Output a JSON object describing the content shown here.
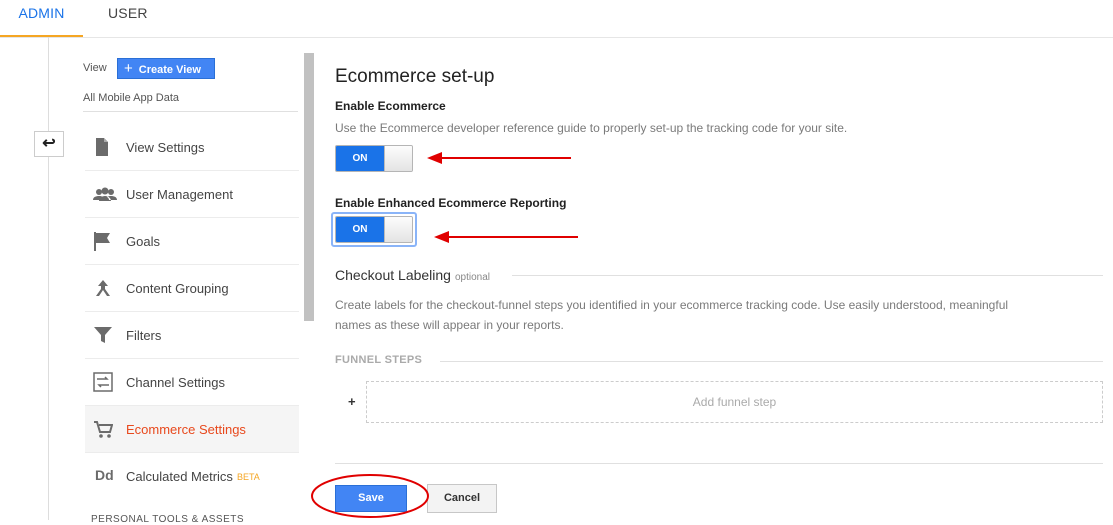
{
  "tabs": {
    "admin": "ADMIN",
    "user": "USER"
  },
  "sidebar": {
    "view_label": "View",
    "create_view": "Create View",
    "view_name": "All Mobile App Data",
    "items": [
      {
        "label": "View Settings",
        "icon": "document-icon"
      },
      {
        "label": "User Management",
        "icon": "people-icon"
      },
      {
        "label": "Goals",
        "icon": "flag-icon"
      },
      {
        "label": "Content Grouping",
        "icon": "grouping-icon"
      },
      {
        "label": "Filters",
        "icon": "filter-icon"
      },
      {
        "label": "Channel Settings",
        "icon": "channel-icon"
      },
      {
        "label": "Ecommerce Settings",
        "icon": "cart-icon",
        "active": true
      },
      {
        "label": "Calculated Metrics",
        "icon": "dd-icon",
        "badge": "BETA"
      }
    ],
    "dd_glyph": "Dd",
    "section": "PERSONAL TOOLS & ASSETS"
  },
  "main": {
    "title": "Ecommerce set-up",
    "enable_ecommerce": {
      "label": "Enable Ecommerce",
      "description": "Use the Ecommerce developer reference guide to properly set-up the tracking code for your site.",
      "toggle": "ON"
    },
    "enable_enhanced": {
      "label": "Enable Enhanced Ecommerce Reporting",
      "toggle": "ON"
    },
    "checkout": {
      "title": "Checkout Labeling",
      "optional": "optional",
      "description_line1": "Create labels for the checkout-funnel steps you identified in your ecommerce tracking code. Use easily understood, meaningful",
      "description_line2": "names as these will appear in your reports."
    },
    "funnel_steps": "FUNNEL STEPS",
    "add_step": "Add funnel step",
    "add_plus": "+",
    "save": "Save",
    "cancel": "Cancel"
  },
  "colors": {
    "accent": "#1a73e8",
    "active_nav": "#e8491d",
    "annotation": "#e00000",
    "tab_underline": "#f5a623"
  }
}
